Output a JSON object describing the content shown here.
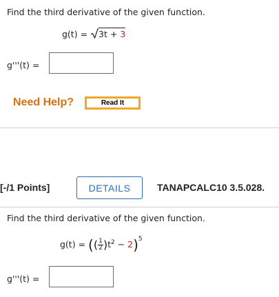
{
  "problem1": {
    "prompt": "Find the third derivative of the given function.",
    "function_lhs": "g(t) = ",
    "radicand_coeff": "3t + ",
    "radicand_const": "3",
    "answer_label": "g'''(t) =",
    "answer_value": "",
    "need_help": "Need Help?",
    "read_it": "Read It"
  },
  "problem2": {
    "points": "[-/1 Points]",
    "details": "DETAILS",
    "course_id": "TANAPCALC10 3.5.028.",
    "prompt": "Find the third derivative of the given function.",
    "function_lhs": "g(t) = ",
    "frac_num": "1",
    "frac_den": "2",
    "var_t": "t",
    "exp_inner": "2",
    "minus": " − ",
    "const": "2",
    "outer_exp": "5",
    "answer_label": "g'''(t) =",
    "answer_value": ""
  },
  "colors": {
    "need_help": "#d86f14",
    "read_it_border": "#f5a623",
    "details_blue": "#2a6ebb",
    "red_constant": "#c81e1e"
  }
}
